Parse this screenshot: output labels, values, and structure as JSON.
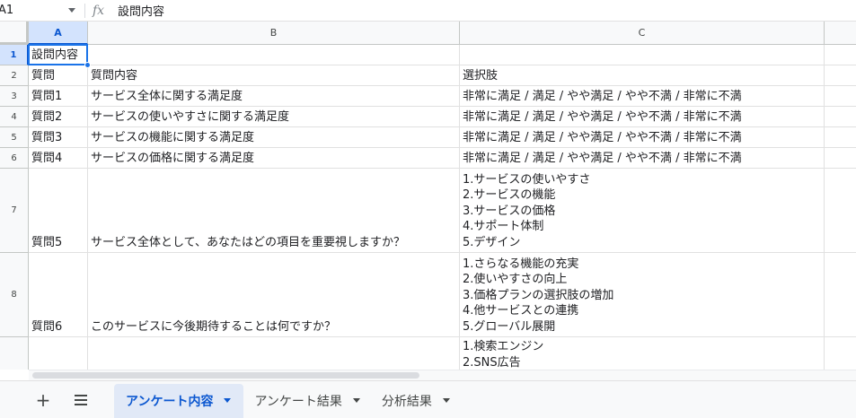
{
  "formula_bar": {
    "name_box": "A1",
    "fx_label": "fx",
    "value": "設問内容"
  },
  "columns": [
    {
      "label": "A"
    },
    {
      "label": "B"
    },
    {
      "label": "C"
    }
  ],
  "rows": [
    {
      "label": "1",
      "cells": [
        "設問内容",
        "",
        ""
      ]
    },
    {
      "label": "2",
      "cells": [
        "質問",
        "質問内容",
        "選択肢"
      ]
    },
    {
      "label": "3",
      "cells": [
        "質問1",
        "サービス全体に関する満足度",
        "非常に満足 / 満足 / やや満足 / やや不満 / 非常に不満"
      ]
    },
    {
      "label": "4",
      "cells": [
        "質問2",
        "サービスの使いやすさに関する満足度",
        "非常に満足 / 満足 / やや満足 / やや不満 / 非常に不満"
      ]
    },
    {
      "label": "5",
      "cells": [
        "質問3",
        "サービスの機能に関する満足度",
        "非常に満足 / 満足 / やや満足 / やや不満 / 非常に不満"
      ]
    },
    {
      "label": "6",
      "cells": [
        "質問4",
        "サービスの価格に関する満足度",
        "非常に満足 / 満足 / やや満足 / やや不満 / 非常に不満"
      ]
    },
    {
      "label": "7",
      "cells": [
        "質問5",
        "サービス全体として、あなたはどの項目を重要視しますか？",
        [
          "1.サービスの使いやすさ",
          "2.サービスの機能",
          "3.サービスの価格",
          "4.サポート体制",
          "5.デザイン"
        ]
      ]
    },
    {
      "label": "8",
      "cells": [
        "質問6",
        "このサービスに今後期待することは何ですか？",
        [
          "1.さらなる機能の充実",
          "2.使いやすさの向上",
          "3.価格プランの選択肢の増加",
          "4.他サービスとの連携",
          "5.グローバル展開"
        ]
      ]
    },
    {
      "label": "",
      "cells": [
        "",
        "",
        [
          "1.検索エンジン",
          "2.SNS広告"
        ]
      ]
    }
  ],
  "sheet_tabs": [
    {
      "label": "アンケート内容",
      "active": true
    },
    {
      "label": "アンケート結果",
      "active": false
    },
    {
      "label": "分析結果",
      "active": false
    }
  ],
  "colors": {
    "accent": "#0b57d0",
    "selection": "#d3e3fd",
    "active_border": "#1a73e8",
    "header_bg": "#f8f9fa"
  }
}
